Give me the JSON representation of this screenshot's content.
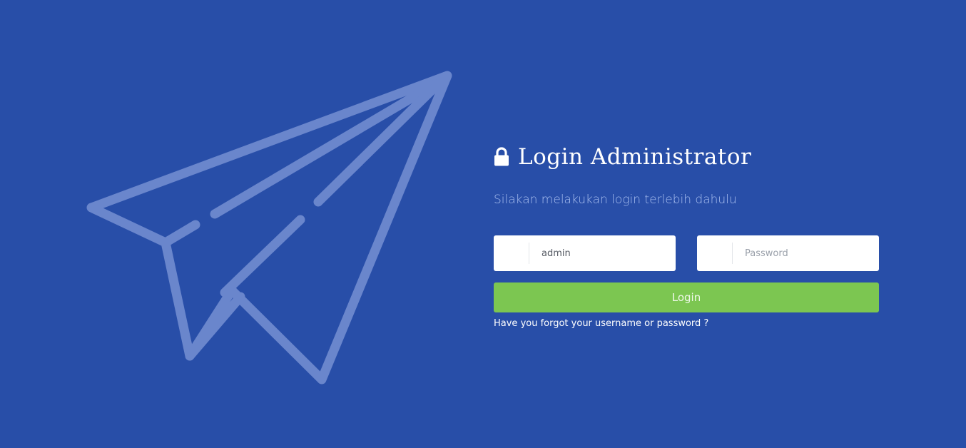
{
  "illustration": {
    "icon": "paper-plane-icon",
    "color": "#6a86cc"
  },
  "header": {
    "icon": "lock-icon",
    "title": "Login Administrator",
    "subtitle": "Silakan melakukan login terlebih dahulu"
  },
  "form": {
    "username": {
      "icon": "user-icon",
      "value": "admin",
      "placeholder": ""
    },
    "password": {
      "icon": "key-icon",
      "value": "",
      "placeholder": "Password"
    },
    "login_label": "Login",
    "forgot_label": "Have you forgot your username or password ?"
  },
  "colors": {
    "background": "#284ea8",
    "accent": "#7cc651",
    "subtitle": "#a9bff0"
  }
}
